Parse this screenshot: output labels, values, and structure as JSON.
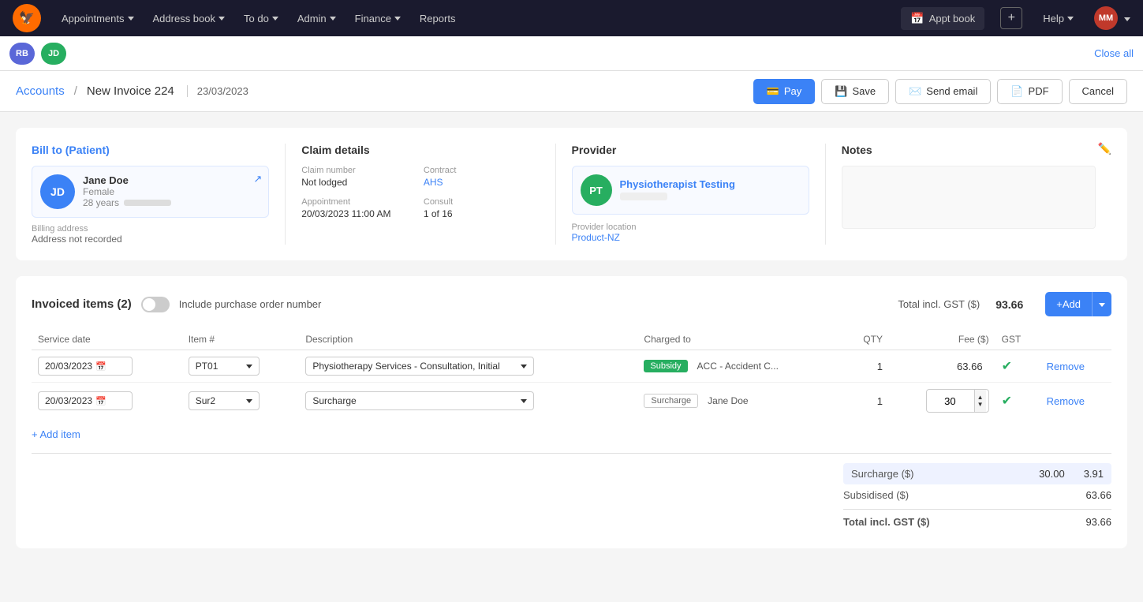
{
  "nav": {
    "logo_text": "🦅",
    "items": [
      {
        "label": "Appointments",
        "has_dropdown": true
      },
      {
        "label": "Address book",
        "has_dropdown": true
      },
      {
        "label": "To do",
        "has_dropdown": true
      },
      {
        "label": "Admin",
        "has_dropdown": true
      },
      {
        "label": "Finance",
        "has_dropdown": true
      },
      {
        "label": "Reports",
        "has_dropdown": false
      }
    ],
    "appt_book_label": "Appt book",
    "help_label": "Help",
    "user_initials": "MM",
    "plus_icon": "+"
  },
  "tabs": [
    {
      "initials": "RB",
      "color": "blue"
    },
    {
      "initials": "JD",
      "color": "green"
    }
  ],
  "close_all_label": "Close all",
  "header": {
    "breadcrumb_accounts": "Accounts",
    "separator": "/",
    "page_title": "New Invoice 224",
    "date": "23/03/2023",
    "btn_pay": "Pay",
    "btn_save": "Save",
    "btn_send_email": "Send email",
    "btn_pdf": "PDF",
    "btn_cancel": "Cancel"
  },
  "bill_to": {
    "title": "Bill to (Patient)",
    "patient": {
      "initials": "JD",
      "name": "Jane Doe",
      "gender": "Female",
      "age": "28 years",
      "dob_placeholder": "••••••••••"
    },
    "billing_address_label": "Billing address",
    "billing_address_value": "Address not recorded"
  },
  "claim_details": {
    "title": "Claim details",
    "claim_number_label": "Claim number",
    "claim_number_value": "Not lodged",
    "contract_label": "Contract",
    "contract_value": "AHS",
    "appointment_label": "Appointment",
    "appointment_value": "20/03/2023 11:00 AM",
    "consult_label": "Consult",
    "consult_value": "1 of 16"
  },
  "provider": {
    "title": "Provider",
    "initials": "PT",
    "name": "Physiotherapist Testing",
    "sub_placeholder": "••••••••",
    "location_label": "Provider location",
    "location_value": "Product-NZ"
  },
  "notes": {
    "title": "Notes"
  },
  "invoiced_items": {
    "title": "Invoiced items (2)",
    "include_purchase_order_label": "Include purchase order number",
    "total_label": "Total incl. GST ($)",
    "total_value": "93.66",
    "columns": {
      "service_date": "Service date",
      "item_hash": "Item #",
      "description": "Description",
      "charged_to": "Charged to",
      "qty": "QTY",
      "fee": "Fee ($)",
      "gst": "GST"
    },
    "rows": [
      {
        "service_date": "20/03/2023",
        "item_code": "PT01",
        "description": "Physiotherapy Services - Consultation, Initial",
        "badge": "Subsidy",
        "badge_type": "subsidy",
        "charged_to": "ACC - Accident C...",
        "qty": "1",
        "fee": "63.66",
        "has_check": true
      },
      {
        "service_date": "20/03/2023",
        "item_code": "Sur2",
        "description": "Surcharge",
        "badge": "Surcharge",
        "badge_type": "surcharge",
        "charged_to": "Jane Doe",
        "qty": "1",
        "fee": "30",
        "has_check": true
      }
    ],
    "add_item_label": "+ Add item",
    "add_btn_label": "+ Add"
  },
  "summary": {
    "surcharge_label": "Surcharge ($)",
    "surcharge_value": "30.00",
    "surcharge_gst": "3.91",
    "subsidised_label": "Subsidised ($)",
    "subsidised_value": "63.66",
    "total_label": "Total incl. GST ($)",
    "total_value": "93.66"
  }
}
